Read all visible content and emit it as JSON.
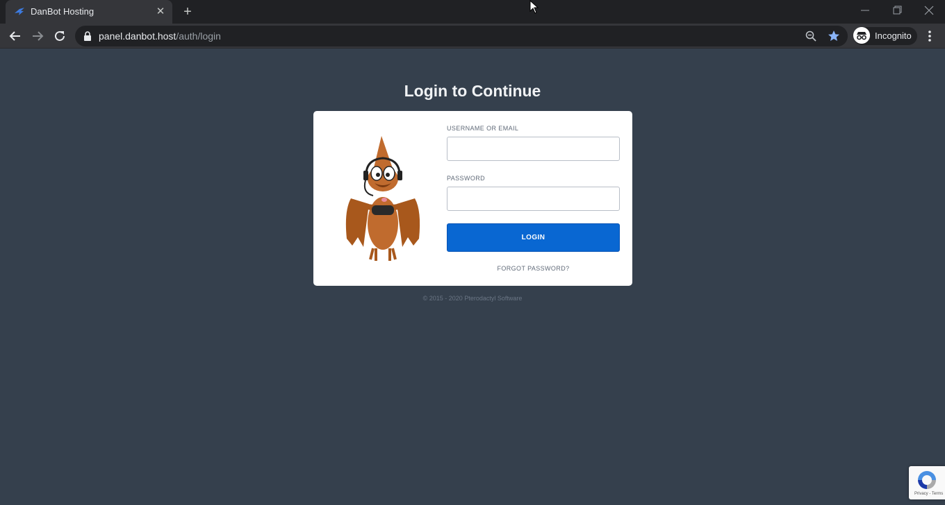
{
  "browser": {
    "tab_title": "DanBot Hosting",
    "url_host": "panel.danbot.host",
    "url_path": "/auth/login",
    "profile_label": "Incognito",
    "icons": [
      "back-icon",
      "forward-icon",
      "reload-icon",
      "lock-icon",
      "zoom-icon",
      "star-icon",
      "incognito-icon",
      "menu-icon",
      "close-icon",
      "plus-icon",
      "minimize-icon",
      "restore-icon"
    ]
  },
  "page": {
    "heading": "Login to Continue",
    "username_label": "USERNAME OR EMAIL",
    "username_value": "",
    "password_label": "PASSWORD",
    "password_value": "",
    "login_label": "LOGIN",
    "forgot_label": "FORGOT PASSWORD?",
    "footer": "© 2015 - 2020 Pterodactyl Software"
  },
  "recaptcha": {
    "text": "Privacy - Terms"
  },
  "colors": {
    "page_bg": "#35404d",
    "login_button": "#0967d2",
    "card_bg": "#ffffff"
  }
}
